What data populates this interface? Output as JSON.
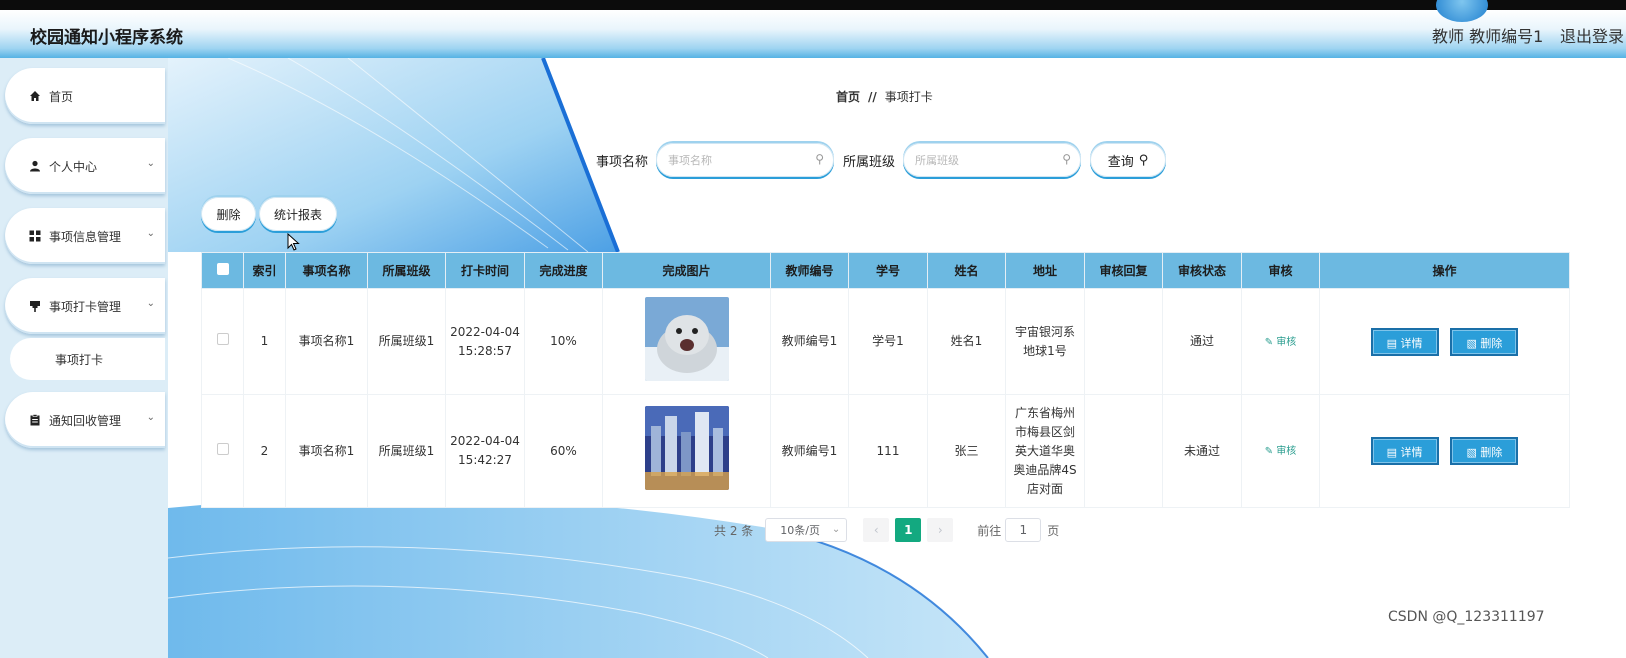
{
  "header": {
    "title": "校园通知小程序系统",
    "user": "教师 教师编号1",
    "logout": "退出登录"
  },
  "sidebar": {
    "items": [
      {
        "label": "首页",
        "icon": "home-icon"
      },
      {
        "label": "个人中心",
        "icon": "user-icon"
      },
      {
        "label": "事项信息管理",
        "icon": "grid-icon"
      },
      {
        "label": "事项打卡管理",
        "icon": "pin-icon"
      },
      {
        "label": "事项打卡",
        "icon": ""
      },
      {
        "label": "通知回收管理",
        "icon": "clipboard-icon"
      }
    ]
  },
  "breadcrumb": {
    "home": "首页",
    "sep": "//",
    "current": "事项打卡"
  },
  "search": {
    "item_label": "事项名称",
    "item_placeholder": "事项名称",
    "class_label": "所属班级",
    "class_placeholder": "所属班级",
    "query_label": "查询"
  },
  "actions": {
    "delete_label": "删除",
    "report_label": "统计报表"
  },
  "table": {
    "headers": [
      "索引",
      "事项名称",
      "所属班级",
      "打卡时间",
      "完成进度",
      "完成图片",
      "教师编号",
      "学号",
      "姓名",
      "地址",
      "审核回复",
      "审核状态",
      "审核",
      "操作"
    ],
    "rows": [
      {
        "index": "1",
        "item_name": "事项名称1",
        "class_name": "所属班级1",
        "time": "2022-04-04 15:28:57",
        "progress": "10%",
        "image": "seal-photo",
        "teacher_no": "教师编号1",
        "student_no": "学号1",
        "name": "姓名1",
        "address": "宇宙银河系地球1号",
        "reply": "",
        "status": "通过",
        "audit": "审核",
        "detail_btn": "详情",
        "delete_btn": "删除"
      },
      {
        "index": "2",
        "item_name": "事项名称1",
        "class_name": "所属班级1",
        "time": "2022-04-04 15:42:27",
        "progress": "60%",
        "image": "city-night-photo",
        "teacher_no": "教师编号1",
        "student_no": "111",
        "name": "张三",
        "address": "广东省梅州市梅县区剑英大道华奥奥迪品牌4S店对面",
        "reply": "",
        "status": "未通过",
        "audit": "审核",
        "detail_btn": "详情",
        "delete_btn": "删除"
      }
    ]
  },
  "pagination": {
    "total": "共 2 条",
    "page_size": "10条/页",
    "current_page": "1",
    "goto_label": "前往",
    "goto_value": "1",
    "page_suffix": "页"
  },
  "watermark": "CSDN @Q_123311197",
  "colors": {
    "header_blue": "#55b2e4",
    "table_header": "#6cb9e1",
    "button_blue": "#2b9ed9",
    "page_active": "#13a980"
  }
}
